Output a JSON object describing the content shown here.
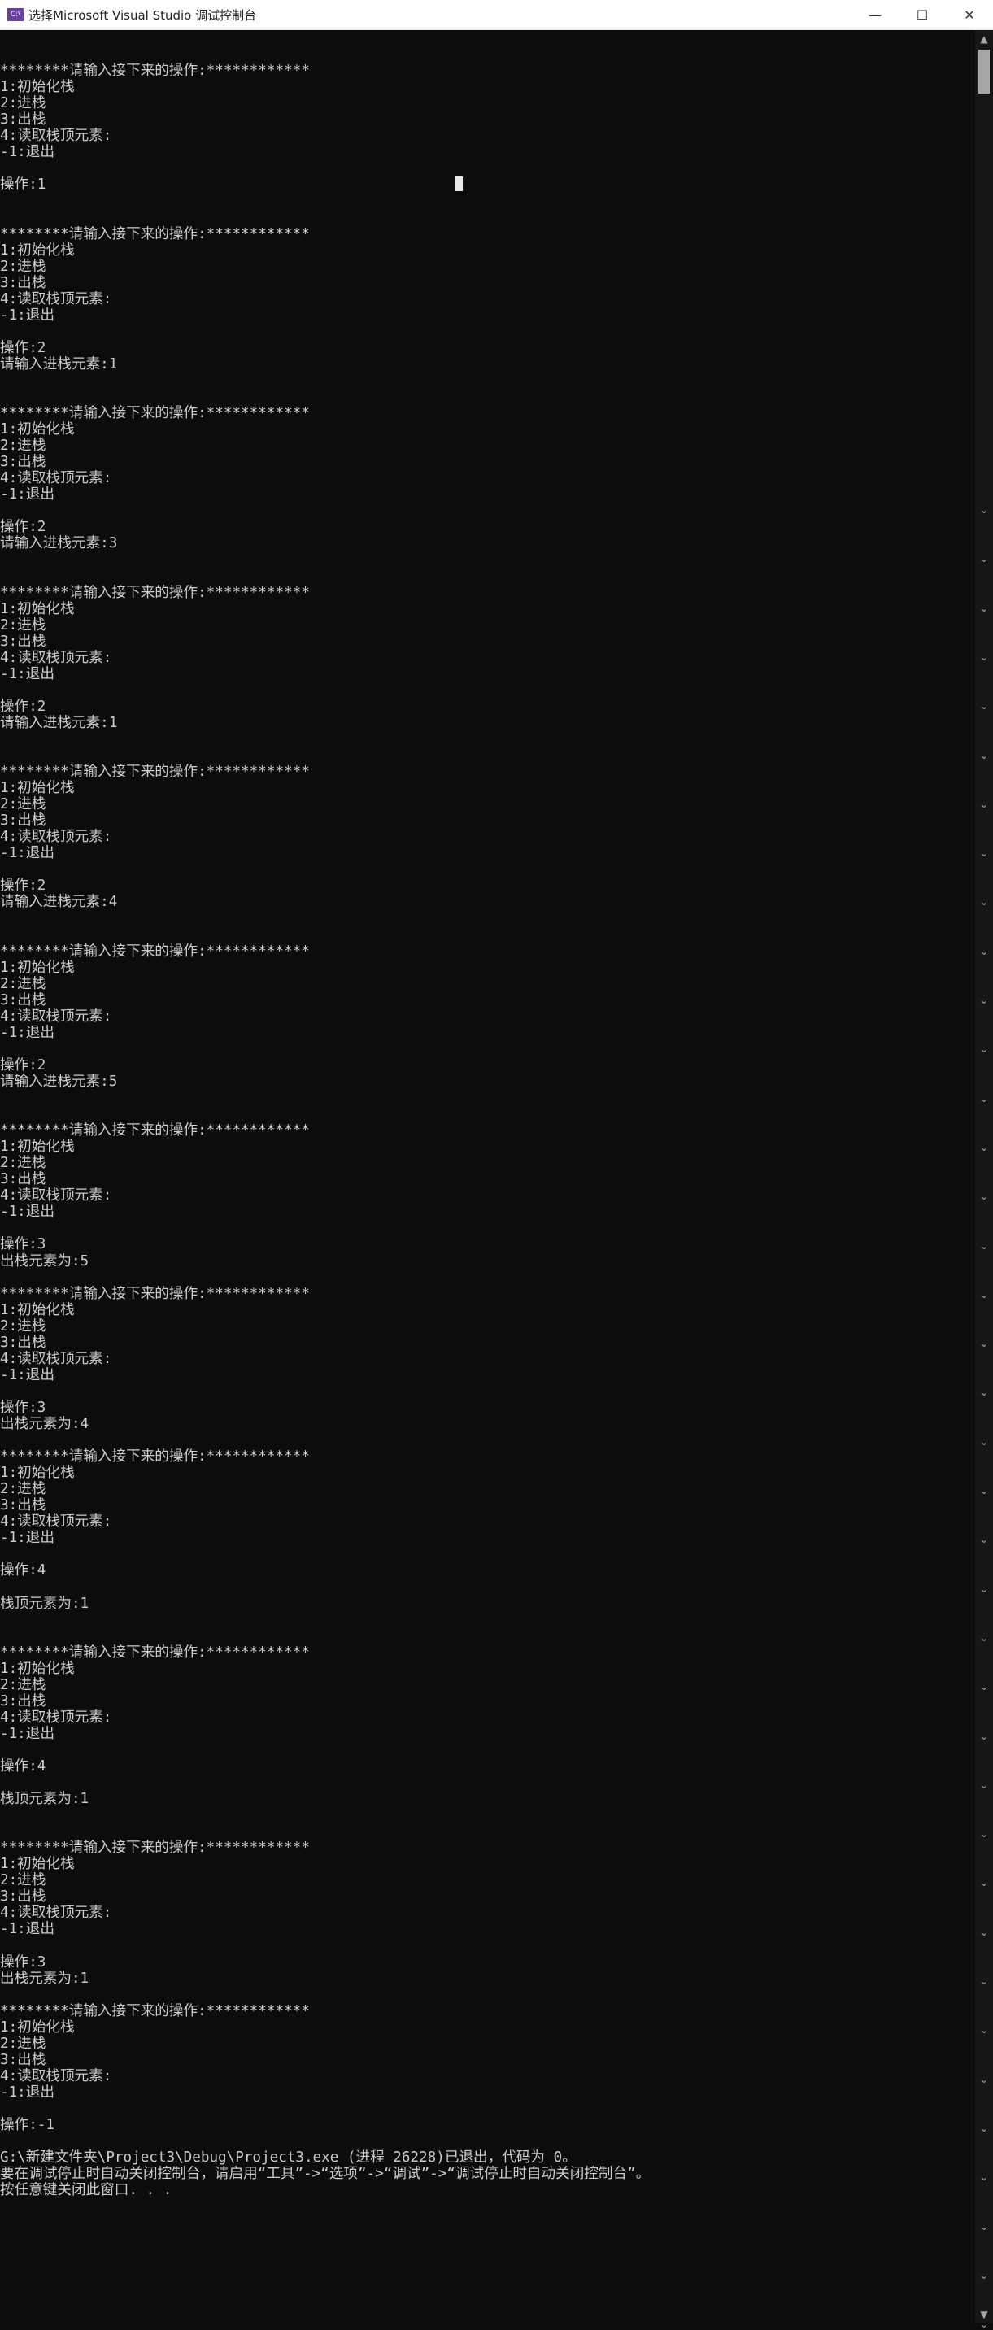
{
  "window": {
    "title": "选择Microsoft Visual Studio 调试控制台",
    "app_icon_text": "C:\\",
    "controls": {
      "minimize": "—",
      "maximize": "☐",
      "close": "✕"
    }
  },
  "scrollbar": {
    "up_arrow": "▲",
    "down_arrow": "▼",
    "markers": "⌄"
  },
  "console": {
    "lines": [
      "",
      "",
      "********请输入接下来的操作:************",
      "1:初始化栈",
      "2:进栈",
      "3:出栈",
      "4:读取栈顶元素:",
      "-1:退出",
      "",
      "操作:1",
      "",
      "",
      "********请输入接下来的操作:************",
      "1:初始化栈",
      "2:进栈",
      "3:出栈",
      "4:读取栈顶元素:",
      "-1:退出",
      "",
      "操作:2",
      "请输入进栈元素:1",
      "",
      "",
      "********请输入接下来的操作:************",
      "1:初始化栈",
      "2:进栈",
      "3:出栈",
      "4:读取栈顶元素:",
      "-1:退出",
      "",
      "操作:2",
      "请输入进栈元素:3",
      "",
      "",
      "********请输入接下来的操作:************",
      "1:初始化栈",
      "2:进栈",
      "3:出栈",
      "4:读取栈顶元素:",
      "-1:退出",
      "",
      "操作:2",
      "请输入进栈元素:1",
      "",
      "",
      "********请输入接下来的操作:************",
      "1:初始化栈",
      "2:进栈",
      "3:出栈",
      "4:读取栈顶元素:",
      "-1:退出",
      "",
      "操作:2",
      "请输入进栈元素:4",
      "",
      "",
      "********请输入接下来的操作:************",
      "1:初始化栈",
      "2:进栈",
      "3:出栈",
      "4:读取栈顶元素:",
      "-1:退出",
      "",
      "操作:2",
      "请输入进栈元素:5",
      "",
      "",
      "********请输入接下来的操作:************",
      "1:初始化栈",
      "2:进栈",
      "3:出栈",
      "4:读取栈顶元素:",
      "-1:退出",
      "",
      "操作:3",
      "出栈元素为:5",
      "",
      "********请输入接下来的操作:************",
      "1:初始化栈",
      "2:进栈",
      "3:出栈",
      "4:读取栈顶元素:",
      "-1:退出",
      "",
      "操作:3",
      "出栈元素为:4",
      "",
      "********请输入接下来的操作:************",
      "1:初始化栈",
      "2:进栈",
      "3:出栈",
      "4:读取栈顶元素:",
      "-1:退出",
      "",
      "操作:4",
      "",
      "栈顶元素为:1",
      "",
      "",
      "********请输入接下来的操作:************",
      "1:初始化栈",
      "2:进栈",
      "3:出栈",
      "4:读取栈顶元素:",
      "-1:退出",
      "",
      "操作:4",
      "",
      "栈顶元素为:1",
      "",
      "",
      "********请输入接下来的操作:************",
      "1:初始化栈",
      "2:进栈",
      "3:出栈",
      "4:读取栈顶元素:",
      "-1:退出",
      "",
      "操作:3",
      "出栈元素为:1",
      "",
      "********请输入接下来的操作:************",
      "1:初始化栈",
      "2:进栈",
      "3:出栈",
      "4:读取栈顶元素:",
      "-1:退出",
      "",
      "操作:-1",
      "",
      "G:\\新建文件夹\\Project3\\Debug\\Project3.exe (进程 26228)已退出，代码为 0。",
      "要在调试停止时自动关闭控制台，请启用“工具”->“选项”->“调试”->“调试停止时自动关闭控制台”。",
      "按任意键关闭此窗口. . ."
    ]
  }
}
